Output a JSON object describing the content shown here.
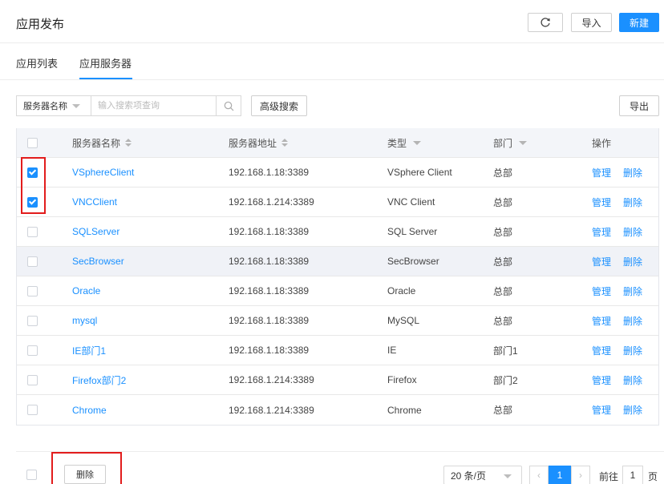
{
  "header": {
    "title": "应用发布",
    "refresh_icon": "refresh-icon",
    "import_label": "导入",
    "new_label": "新建",
    "accent": "#1a90ff"
  },
  "tabs": [
    {
      "label": "应用列表",
      "active": false
    },
    {
      "label": "应用服务器",
      "active": true
    }
  ],
  "filter": {
    "field_label": "服务器名称",
    "search_placeholder": "输入搜索项查询",
    "search_icon": "search-icon",
    "advanced_label": "高级搜索",
    "export_label": "导出"
  },
  "table": {
    "columns": [
      "服务器名称",
      "服务器地址",
      "类型",
      "部门",
      "操作"
    ],
    "manage_label": "管理",
    "delete_label": "删除",
    "rows": [
      {
        "name": "VSphereClient",
        "address": "192.168.1.18:3389",
        "type": "VSphere Client",
        "dept": "总部",
        "checked": true
      },
      {
        "name": "VNCClient",
        "address": "192.168.1.214:3389",
        "type": "VNC Client",
        "dept": "总部",
        "checked": true
      },
      {
        "name": "SQLServer",
        "address": "192.168.1.18:3389",
        "type": "SQL Server",
        "dept": "总部",
        "checked": false
      },
      {
        "name": "SecBrowser",
        "address": "192.168.1.18:3389",
        "type": "SecBrowser",
        "dept": "总部",
        "checked": false
      },
      {
        "name": "Oracle",
        "address": "192.168.1.18:3389",
        "type": "Oracle",
        "dept": "总部",
        "checked": false
      },
      {
        "name": "mysql",
        "address": "192.168.1.18:3389",
        "type": "MySQL",
        "dept": "总部",
        "checked": false
      },
      {
        "name": "IE部门1",
        "address": "192.168.1.18:3389",
        "type": "IE",
        "dept": "部门1",
        "checked": false
      },
      {
        "name": "Firefox部门2",
        "address": "192.168.1.214:3389",
        "type": "Firefox",
        "dept": "部门2",
        "checked": false
      },
      {
        "name": "Chrome",
        "address": "192.168.1.214:3389",
        "type": "Chrome",
        "dept": "总部",
        "checked": false
      }
    ]
  },
  "footer": {
    "delete_label": "删除",
    "page_size": "20 条/页",
    "current_page": "1",
    "goto_label": "前往",
    "goto_value": "1",
    "page_suffix": "页"
  },
  "colors": {
    "accent": "#1a90ff",
    "annotation": "#e21c1c",
    "header_row": "#f3f5f9"
  }
}
